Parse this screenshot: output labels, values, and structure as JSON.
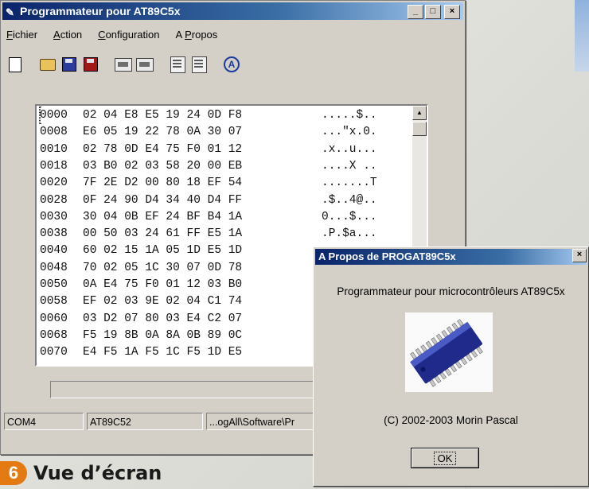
{
  "window": {
    "title": "Programmateur pour AT89C5x",
    "controls": {
      "minimize": "_",
      "maximize": "□",
      "close": "×"
    }
  },
  "menu": [
    {
      "pre": "",
      "u": "F",
      "post": "ichier"
    },
    {
      "pre": "",
      "u": "A",
      "post": "ction"
    },
    {
      "pre": "",
      "u": "C",
      "post": "onfiguration"
    },
    {
      "pre": "A ",
      "u": "P",
      "post": "ropos"
    }
  ],
  "toolbar_icons": [
    "new-file-icon",
    "open-folder-icon",
    "save-icon",
    "save-as-icon",
    "read-chip-icon",
    "write-chip-icon",
    "view-doc-icon",
    "config-doc-icon",
    "about-icon"
  ],
  "about_icon_glyph": "A",
  "hex_rows": [
    {
      "addr": "0000",
      "bytes": "02 04 E8 E5 19 24 0D F8",
      "ascii": ".....$.."
    },
    {
      "addr": "0008",
      "bytes": "E6 05 19 22 78 0A 30 07",
      "ascii": "...\"x.0."
    },
    {
      "addr": "0010",
      "bytes": "02 78 0D E4 75 F0 01 12",
      "ascii": ".x..u..."
    },
    {
      "addr": "0018",
      "bytes": "03 B0 02 03 58 20 00 EB",
      "ascii": "....X .."
    },
    {
      "addr": "0020",
      "bytes": "7F 2E D2 00 80 18 EF 54",
      "ascii": ".......T"
    },
    {
      "addr": "0028",
      "bytes": "0F 24 90 D4 34 40 D4 FF",
      "ascii": ".$..4@.."
    },
    {
      "addr": "0030",
      "bytes": "30 04 0B EF 24 BF B4 1A",
      "ascii": "0...$..."
    },
    {
      "addr": "0038",
      "bytes": "00 50 03 24 61 FF E5 1A",
      "ascii": ".P.$a..."
    },
    {
      "addr": "0040",
      "bytes": "60 02 15 1A 05 1D E5 1D",
      "ascii": ""
    },
    {
      "addr": "0048",
      "bytes": "70 02 05 1C 30 07 0D 78",
      "ascii": ""
    },
    {
      "addr": "0050",
      "bytes": "0A E4 75 F0 01 12 03 B0",
      "ascii": ""
    },
    {
      "addr": "0058",
      "bytes": "EF 02 03 9E 02 04 C1 74",
      "ascii": ""
    },
    {
      "addr": "0060",
      "bytes": "03 D2 07 80 03 E4 C2 07",
      "ascii": ""
    },
    {
      "addr": "0068",
      "bytes": "F5 19 8B 0A 8A 0B 89 0C",
      "ascii": ""
    },
    {
      "addr": "0070",
      "bytes": "E4 F5 1A F5 1C F5 1D E5",
      "ascii": ""
    }
  ],
  "status": {
    "port": "COM4",
    "device": "AT89C52",
    "path": "...ogAll\\Software\\Pr"
  },
  "progress_fraction": 0,
  "about_dialog": {
    "title": "A Propos de PROGAT89C5x",
    "close": "×",
    "message": "Programmateur pour microcontrôleurs AT89C5x",
    "copyright": "(C) 2002-2003 Morin Pascal",
    "ok_label": "OK"
  },
  "caption": {
    "badge": "6",
    "text": "Vue d’écran"
  }
}
